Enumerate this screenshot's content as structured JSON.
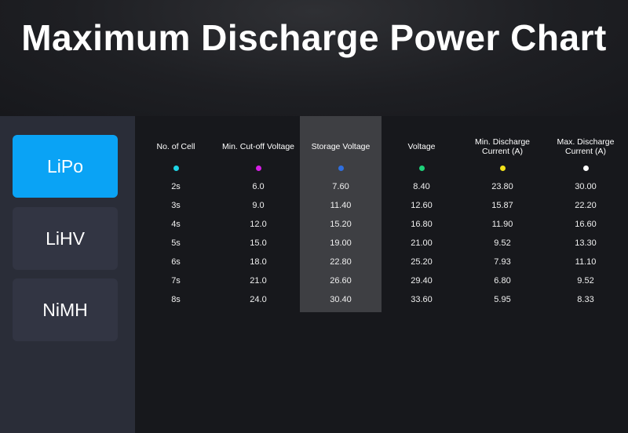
{
  "header": {
    "title": "Maximum Discharge Power Chart"
  },
  "sidebar": {
    "tabs": [
      {
        "label": "LiPo",
        "active": true
      },
      {
        "label": "LiHV",
        "active": false
      },
      {
        "label": "NiMH",
        "active": false
      }
    ]
  },
  "table": {
    "columns": [
      {
        "label": "No. of Cell",
        "dot_color": "#1ed4e6"
      },
      {
        "label": "Min. Cut-off Voltage",
        "dot_color": "#d61ee6"
      },
      {
        "label": "Storage Voltage",
        "dot_color": "#2f6fe0"
      },
      {
        "label": "Voltage",
        "dot_color": "#1ed27a"
      },
      {
        "label": "Min. Discharge Current (A)",
        "dot_color": "#f2e21a"
      },
      {
        "label": "Max. Discharge Current (A)",
        "dot_color": "#ffffff"
      }
    ],
    "highlighted_column": "Storage Voltage",
    "rows": [
      [
        "2s",
        "6.0",
        "7.60",
        "8.40",
        "23.80",
        "30.00"
      ],
      [
        "3s",
        "9.0",
        "11.40",
        "12.60",
        "15.87",
        "22.20"
      ],
      [
        "4s",
        "12.0",
        "15.20",
        "16.80",
        "11.90",
        "16.60"
      ],
      [
        "5s",
        "15.0",
        "19.00",
        "21.00",
        "9.52",
        "13.30"
      ],
      [
        "6s",
        "18.0",
        "22.80",
        "25.20",
        "7.93",
        "11.10"
      ],
      [
        "7s",
        "21.0",
        "26.60",
        "29.40",
        "6.80",
        "9.52"
      ],
      [
        "8s",
        "24.0",
        "30.40",
        "33.60",
        "5.95",
        "8.33"
      ]
    ]
  }
}
